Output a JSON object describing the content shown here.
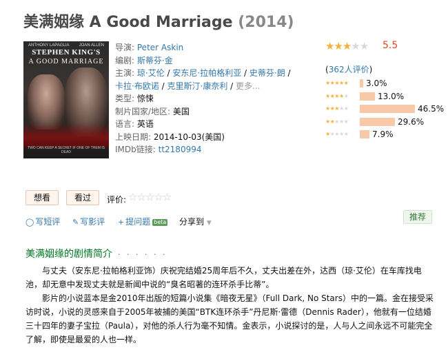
{
  "title": {
    "main": "美满姻缘 A Good Marriage",
    "year": "(2014)"
  },
  "poster": {
    "actor1": "ANTHONY LAPAGLIA",
    "actor2": "JOAN ALLEN",
    "line1": "STEPHEN KING'S",
    "line2": "A GOOD MARRIAGE",
    "tagline": "TWO CAN KEEP A SECRET IF ONE OF THEM IS DEAD"
  },
  "info": {
    "director_label": "导演:",
    "director": "Peter Askin",
    "writer_label": "编剧:",
    "writer": "斯蒂芬·金",
    "cast_label": "主演:",
    "cast": [
      "琼·艾伦",
      "安东尼·拉帕格利亚",
      "史蒂芬·朗",
      "卡拉·布欧诺",
      "克里斯汀·康奈利"
    ],
    "cast_sep": " / ",
    "cast_more": "更多...",
    "genre_label": "类型:",
    "genre": "惊悚",
    "country_label": "制片国家/地区:",
    "country": "美国",
    "language_label": "语言:",
    "language": "英语",
    "release_label": "上映日期:",
    "release": "2014-10-03(美国)",
    "imdb_label": "IMDb链接:",
    "imdb": "tt2180994"
  },
  "rating": {
    "score": "5.5",
    "stars_filled": 2.5,
    "votes_prefix": "(",
    "votes_link": "362人评价",
    "votes_suffix": ")",
    "distribution": [
      {
        "stars": 5,
        "percent": 3.0,
        "label": "3.0%"
      },
      {
        "stars": 4,
        "percent": 13.0,
        "label": "13.0%"
      },
      {
        "stars": 3,
        "percent": 46.5,
        "label": "46.5%"
      },
      {
        "stars": 2,
        "percent": 29.6,
        "label": "29.6%"
      },
      {
        "stars": 1,
        "percent": 7.9,
        "label": "7.9%"
      }
    ],
    "star_color": "#f5b03c",
    "bar_color": "#f7c9a8"
  },
  "buttons": {
    "want": "想看",
    "seen": "看过",
    "rate_label": "评价:"
  },
  "actions": {
    "short_review": "写短评",
    "review": "写影评",
    "question": "提问题",
    "beta": "beta",
    "share": "分享到",
    "recommend": "推荐"
  },
  "summary": {
    "title": "美满姻缘的剧情简介",
    "dots": "· · · · · ·",
    "p1": "与丈夫（安东尼·拉帕格利亚饰）庆祝完结婚25周年后不久，丈夫出差在外，达西（琼·艾伦）在车库找电池，却无意中发现丈夫就是新闻中说的“臭名昭著的连环杀手比蒂”。",
    "p2": "影片的小说蓝本是金2010年出版的短篇小说集《暗夜无星》（Full Dark, No Stars）中的一篇。金在接受采访时说，小说的灵感来自于2005年被捕的美国“BTK连环杀手”丹尼斯·雷德（Dennis Rader），他就有一位结婚三十四年的妻子宝拉（Paula），对他的杀人行为毫不知情。金表示，小说探讨的是，人与人之间永远不可能完全了解，即使是最爱的人也一样。"
  }
}
